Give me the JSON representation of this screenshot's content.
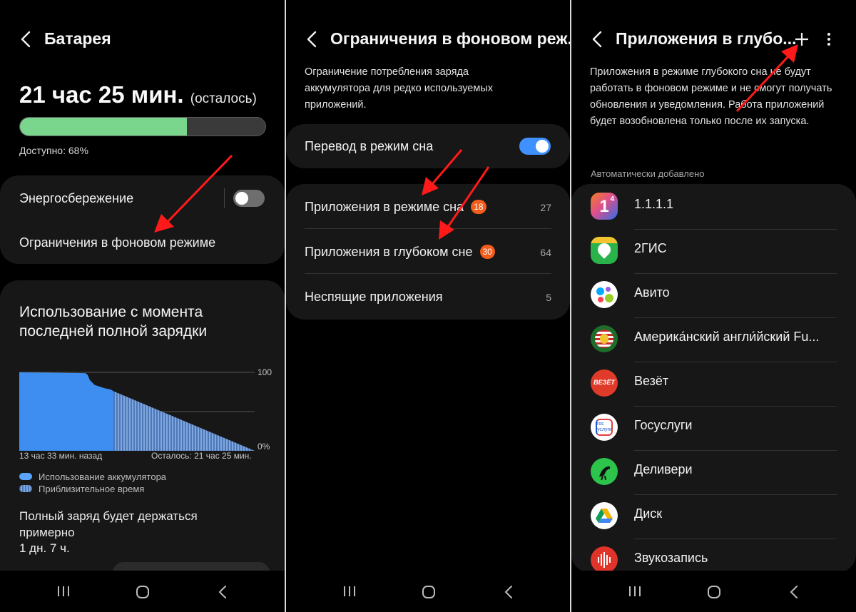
{
  "battery": {
    "title": "Батарея",
    "time_remaining": "21 час 25 мин.",
    "time_suffix": "(осталось)",
    "level_percent": 68,
    "available": "Доступно: 68%",
    "power_saving_label": "Энергосбережение",
    "power_saving_on": false,
    "background_limits_label": "Ограничения в фоновом режиме",
    "usage_title": "Использование с момента последней полной зарядки",
    "chart": {
      "y_top": "100",
      "y_bottom": "0%",
      "x_left": "13 час 33 мин. назад",
      "x_right": "Осталось: 21 час 25 мин.",
      "legend": [
        "Использование аккумулятора",
        "Приблизительное время"
      ]
    },
    "full_charge_text": "Полный заряд будет держаться примерно",
    "full_charge_value": "1 дн. 7 ч."
  },
  "chart_data": {
    "type": "area",
    "series": [
      {
        "name": "Использование аккумулятора",
        "x": [
          0,
          0.28,
          0.29,
          0.3,
          0.32,
          0.36,
          0.39,
          0.4
        ],
        "y": [
          100,
          99,
          97,
          90,
          84,
          80,
          78,
          76
        ]
      },
      {
        "name": "Приблизительное время",
        "x": [
          0.4,
          1.0
        ],
        "y": [
          76,
          0
        ]
      }
    ],
    "ylim": [
      0,
      100
    ],
    "grid": true
  },
  "background": {
    "title": "Ограничения в фоновом реж...",
    "description": "Ограничение потребления заряда аккумулятора для редко используемых приложений.",
    "sleep_mode_label": "Перевод в режим сна",
    "sleep_mode_on": true,
    "items": [
      {
        "label": "Приложения в режиме сна",
        "badge": "18",
        "count": "27"
      },
      {
        "label": "Приложения в глубоком сне",
        "badge": "30",
        "count": "64"
      },
      {
        "label": "Неспящие приложения",
        "badge": "",
        "count": "5"
      }
    ]
  },
  "deep_sleep": {
    "title": "Приложения в глубо...",
    "description": "Приложения в режиме глубокого сна не будут работать в фоновом режиме и не смогут получать обновления и уведомления. Работа приложений будет возобновлена только после их запуска.",
    "section_label": "Автоматически добавлено",
    "apps": [
      {
        "name": "1.1.1.1",
        "icon": "cloudflare-1111-icon",
        "bg": "#2c6ee8"
      },
      {
        "name": "2ГИС",
        "icon": "2gis-icon",
        "bg": "#29b34a"
      },
      {
        "name": "Авито",
        "icon": "avito-icon",
        "bg": "#ffffff"
      },
      {
        "name": "Америка́нский англи́йский Fu...",
        "icon": "american-english-icon",
        "bg": "#1d6e2a"
      },
      {
        "name": "Везёт",
        "icon": "vezet-icon",
        "bg": "#e03a2a"
      },
      {
        "name": "Госуслуги",
        "icon": "gosuslugi-icon",
        "bg": "#ffffff"
      },
      {
        "name": "Деливери",
        "icon": "delivery-club-icon",
        "bg": "#2cc44a"
      },
      {
        "name": "Диск",
        "icon": "google-drive-icon",
        "bg": "#ffffff"
      },
      {
        "name": "Звукозапись",
        "icon": "voice-recorder-icon",
        "bg": "#e0332a"
      }
    ],
    "icon_labels": {
      "one": "1",
      "four": "4",
      "vezet": "ВЕЗЁТ",
      "gos_top": "гос",
      "gos_bottom": "услуги"
    }
  },
  "colors": {
    "accent": "#3e91ff",
    "chart_blue": "#3d8ef0",
    "annotation_red": "#ff1a1a",
    "bar_green": "#7ad68c"
  }
}
